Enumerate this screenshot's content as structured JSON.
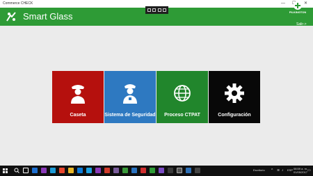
{
  "window": {
    "title": "Commerce CHECK",
    "minimize_glyph": "—",
    "maximize_glyph": "☐",
    "close_glyph": "✕"
  },
  "header": {
    "app_title": "Smart Glass",
    "brand_name": "PILKINGTON",
    "exit_link": "Salir->",
    "color": "#2e9b36"
  },
  "tiles": [
    {
      "label": "Caseta",
      "icon": "security-guard-icon",
      "color": "#b5100d"
    },
    {
      "label": "Sistema de Seguridad",
      "icon": "officer-icon",
      "color": "#2e79c1"
    },
    {
      "label": "Proceso CTPAT",
      "icon": "globe-icon",
      "color": "#21862c"
    },
    {
      "label": "Configuración",
      "icon": "gear-icon",
      "color": "#080808"
    }
  ],
  "taskbar": {
    "tray_label": "Escritorio",
    "language": "ESP",
    "time": "08:59 a. m.",
    "date": "01/05/2017"
  }
}
